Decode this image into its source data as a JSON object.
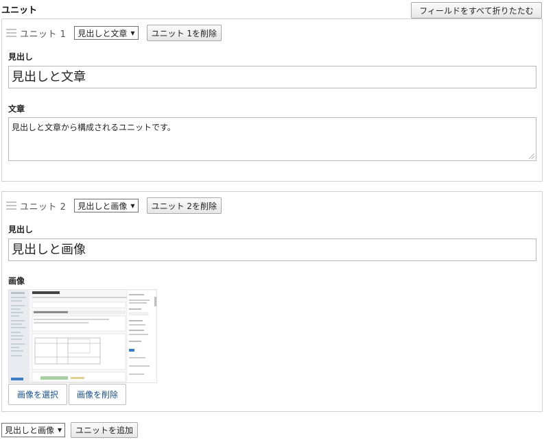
{
  "section": {
    "title": "ユニット",
    "collapse_all_label": "フィールドをすべて折りたたむ"
  },
  "units": [
    {
      "label": "ユニット 1",
      "type_selected": "見出しと文章",
      "delete_label": "ユニット 1を削除",
      "heading_label": "見出し",
      "heading_value": "見出しと文章",
      "text_label": "文章",
      "text_value": "見出しと文章から構成されるユニットです。"
    },
    {
      "label": "ユニット 2",
      "type_selected": "見出しと画像",
      "delete_label": "ユニット 2を削除",
      "heading_label": "見出し",
      "heading_value": "見出しと画像",
      "image_label": "画像",
      "select_image_label": "画像を選択",
      "delete_image_label": "画像を削除"
    }
  ],
  "footer": {
    "new_unit_type": "見出しと画像",
    "add_unit_label": "ユニットを追加"
  },
  "icons": {
    "drag": "drag-handle-icon",
    "dropdown": "chevron-down-icon",
    "resize": "resize-grip-icon"
  },
  "colors": {
    "border": "#d0d0d0",
    "input_border": "#b7b7b7",
    "link_text": "#1a4f8a"
  }
}
